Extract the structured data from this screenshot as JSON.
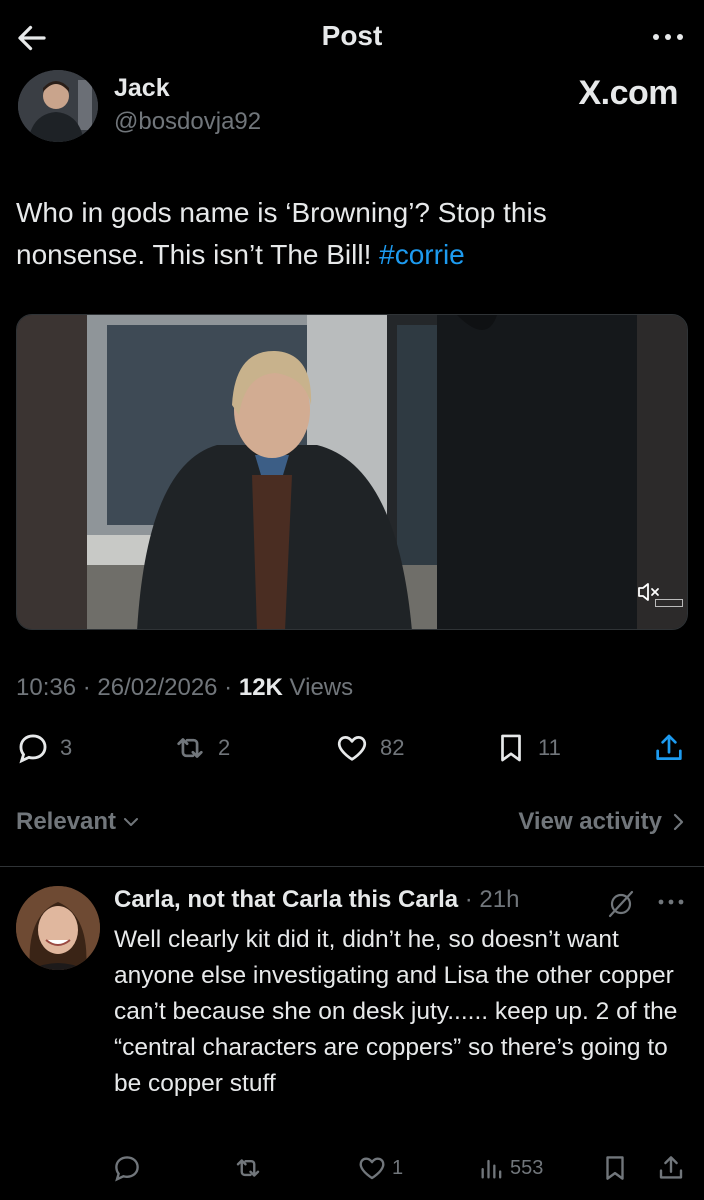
{
  "header": {
    "title": "Post",
    "back_icon": "arrow-left-icon",
    "more_icon": "more-horizontal-icon"
  },
  "post": {
    "author": {
      "name": "Jack",
      "handle": "@bosdovja92"
    },
    "watermark": "X.com",
    "text_lines": [
      "Who in gods name is ‘Browning’? Stop this",
      "nonsense. This isn’t The Bill! "
    ],
    "hashtag": "#corrie",
    "media": {
      "type": "video",
      "muted_icon": "volume-mute-icon"
    },
    "time": "10:36",
    "date": "26/02/2026",
    "separator": " · ",
    "views_count": "12K",
    "views_label": " Views",
    "stats": {
      "replies": "3",
      "reposts": "2",
      "likes": "82",
      "bookmarks": "11"
    }
  },
  "sort": {
    "label": "Relevant",
    "view_activity": "View activity"
  },
  "reply": {
    "name": "Carla, not that Carla this Carla",
    "time": " · 21h",
    "text": "Well clearly kit did it, didn’t he, so doesn’t want anyone else investigating and Lisa the other copper can’t because she on desk juty...... keep up. 2 of the “central characters are coppers” so there’s going to be copper stuff",
    "stats": {
      "replies": "",
      "reposts": "",
      "likes": "1",
      "views": "553"
    }
  },
  "colors": {
    "background": "#000000",
    "text": "#e7e9ea",
    "muted": "#71767b",
    "link": "#1d9bf0",
    "divider": "#2f3336"
  }
}
